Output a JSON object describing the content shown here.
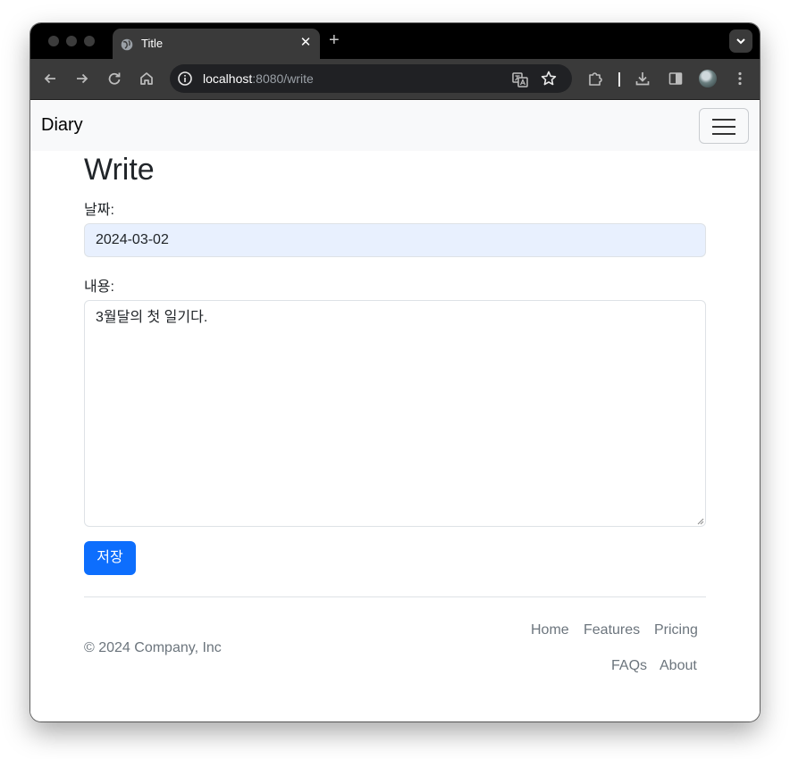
{
  "browser": {
    "tab_title": "Title",
    "tab_close": "✕",
    "new_tab": "+",
    "url_host": "localhost",
    "url_rest": ":8080/write",
    "icons": [
      "globe-icon",
      "back-icon",
      "forward-icon",
      "reload-icon",
      "home-icon",
      "info-icon",
      "translate-icon",
      "star-icon",
      "extensions-icon",
      "download-icon",
      "sidepanel-icon",
      "menu-icon",
      "chevron-down-icon"
    ]
  },
  "navbar": {
    "brand": "Diary"
  },
  "page": {
    "title": "Write",
    "date_label": "날짜:",
    "date_value": "2024-03-02",
    "content_label": "내용:",
    "content_value": "3월달의 첫 일기다.",
    "save_button": "저장"
  },
  "footer": {
    "copyright": "© 2024 Company, Inc",
    "links": [
      "Home",
      "Features",
      "Pricing",
      "FAQs",
      "About"
    ]
  },
  "colors": {
    "primary": "#0d6efd",
    "autofill_bg": "#e8f0fe",
    "navbar_bg": "#f8f9fa",
    "muted_text": "#6c757d"
  }
}
